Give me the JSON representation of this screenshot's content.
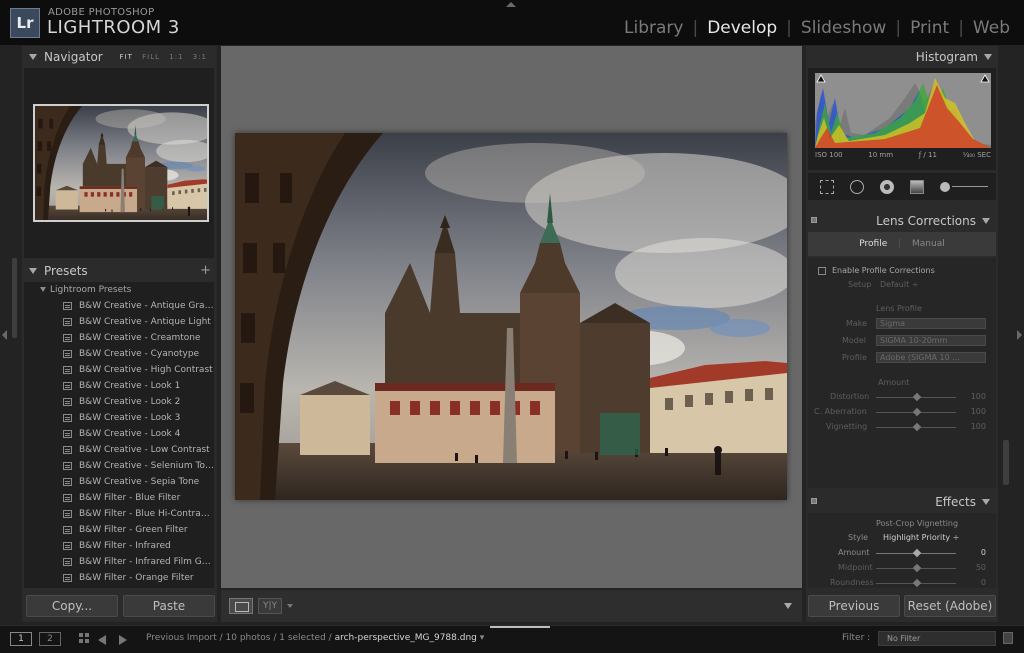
{
  "app": {
    "logo_text": "Lr",
    "brand_sub": "ADOBE PHOTOSHOP",
    "brand_main": "LIGHTROOM 3",
    "modules": [
      {
        "label": "Library",
        "active": false
      },
      {
        "label": "Develop",
        "active": true
      },
      {
        "label": "Slideshow",
        "active": false
      },
      {
        "label": "Print",
        "active": false
      },
      {
        "label": "Web",
        "active": false
      }
    ]
  },
  "navigator": {
    "title": "Navigator",
    "options": [
      "FIT",
      "FILL",
      "1:1",
      "3:1"
    ]
  },
  "presets": {
    "title": "Presets",
    "add": "+",
    "folder": "Lightroom Presets",
    "items": [
      "B&W Creative - Antique Gray...",
      "B&W Creative - Antique Light",
      "B&W Creative - Creamtone",
      "B&W Creative - Cyanotype",
      "B&W Creative - High Contrast",
      "B&W Creative - Look 1",
      "B&W Creative - Look 2",
      "B&W Creative - Look 3",
      "B&W Creative - Look 4",
      "B&W Creative - Low Contrast",
      "B&W Creative - Selenium Tone",
      "B&W Creative - Sepia Tone",
      "B&W Filter - Blue Filter",
      "B&W Filter - Blue Hi-Contrast ...",
      "B&W Filter - Green Filter",
      "B&W Filter - Infrared",
      "B&W Filter - Infrared Film Grain",
      "B&W Filter - Orange Filter"
    ]
  },
  "left_buttons": {
    "copy": "Copy...",
    "paste": "Paste"
  },
  "histogram": {
    "title": "Histogram",
    "iso": "ISO 100",
    "focal": "10 mm",
    "aperture": "ƒ / 11",
    "shutter": "¹⁄₄₀₀ SEC"
  },
  "lens": {
    "title": "Lens Corrections",
    "tab_profile": "Profile",
    "tab_manual": "Manual",
    "enable": "Enable Profile Corrections",
    "setup_label": "Setup",
    "setup_value": "Default ÷",
    "section_profile": "Lens Profile",
    "make_label": "Make",
    "make_value": "Sigma",
    "model_label": "Model",
    "model_value": "SIGMA 10-20mm",
    "profile_label": "Profile",
    "profile_value": "Adobe (SIGMA 10 ...",
    "section_amount": "Amount",
    "distortion_label": "Distortion",
    "distortion_value": "100",
    "aberration_label": "C. Aberration",
    "aberration_value": "100",
    "vignetting_label": "Vignetting",
    "vignetting_value": "100"
  },
  "effects": {
    "title": "Effects",
    "section": "Post-Crop Vignetting",
    "style_label": "Style",
    "style_value": "Highlight Priority ÷",
    "amount_label": "Amount",
    "amount_value": "0",
    "midpoint_label": "Midpoint",
    "midpoint_value": "50",
    "roundness_label": "Roundness",
    "roundness_value": "0"
  },
  "right_buttons": {
    "previous": "Previous",
    "reset": "Reset (Adobe)"
  },
  "toolbar": {
    "yy_label": "Y|Y"
  },
  "filmstrip": {
    "mon1": "1",
    "mon2": "2",
    "breadcrumb": "Previous Import / 10 photos / 1 selected / ",
    "filename": "arch-perspective_MG_9788.dng",
    "filename_arrow": " ▾",
    "filter_label": "Filter :",
    "filter_value": "No Filter"
  },
  "colors": {
    "panel_bg": "#2b2b2b",
    "center_bg": "#686868",
    "active_module": "#e8e8e8"
  }
}
